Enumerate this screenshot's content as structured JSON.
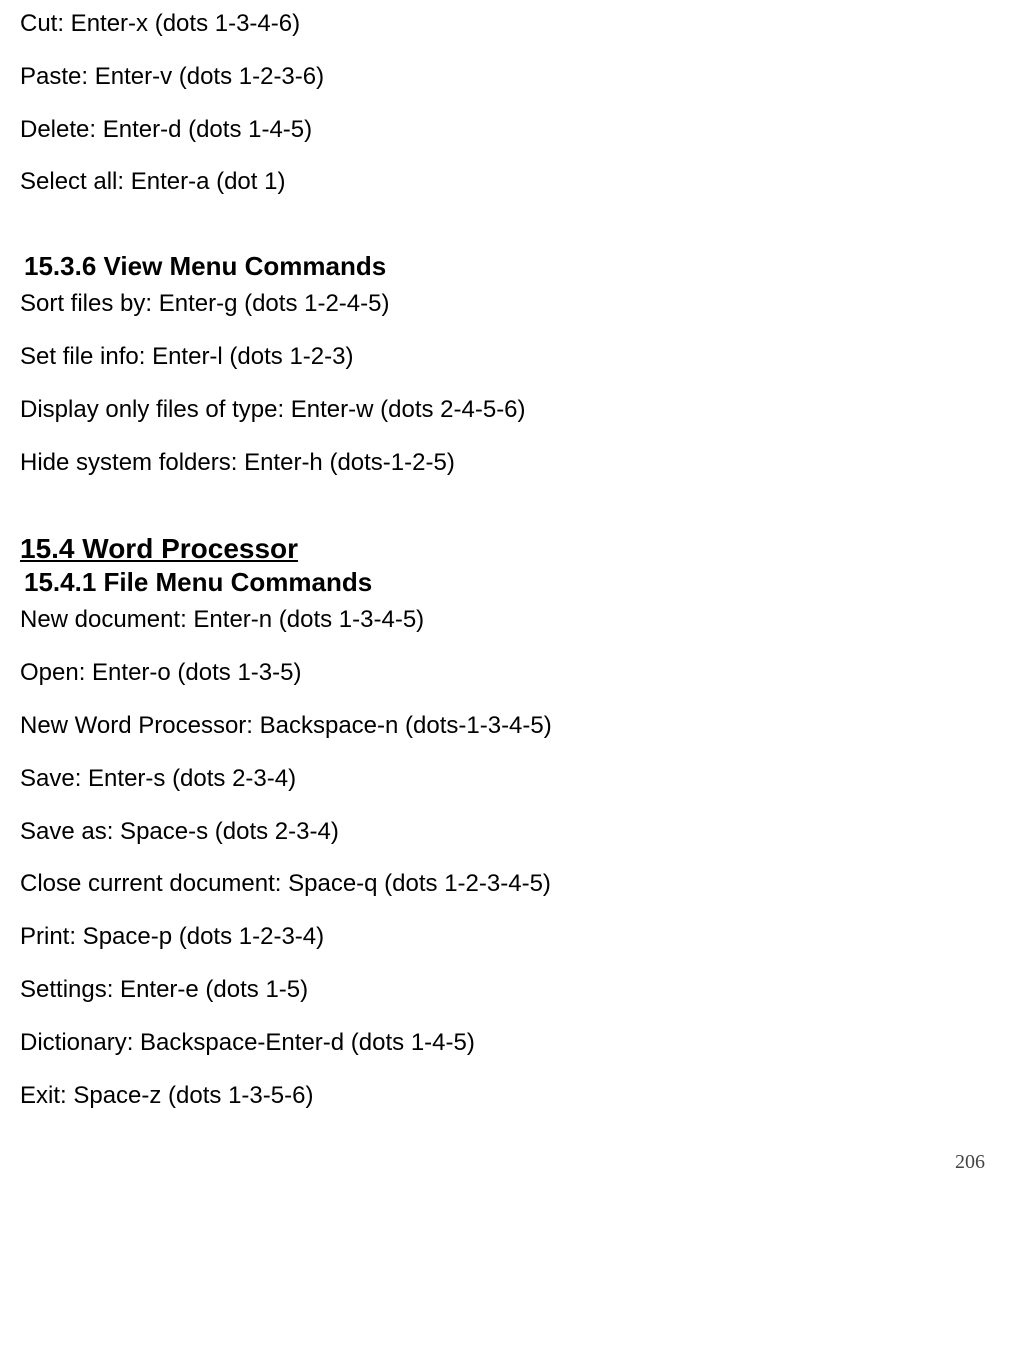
{
  "intro_cmds": [
    "Cut: Enter-x (dots 1-3-4-6)",
    "Paste: Enter-v (dots 1-2-3-6)",
    "Delete: Enter-d (dots 1-4-5)",
    "Select all: Enter-a (dot 1)"
  ],
  "view_menu": {
    "heading": "15.3.6 View Menu Commands",
    "cmds": [
      "Sort files by: Enter-g (dots 1-2-4-5)",
      "Set file info: Enter-l (dots 1-2-3)",
      "Display only files of type: Enter-w (dots 2-4-5-6)",
      "Hide system folders: Enter-h (dots-1-2-5)"
    ]
  },
  "word_processor": {
    "heading": "15.4 Word Processor",
    "file_menu": {
      "heading": "15.4.1 File Menu Commands",
      "cmds": [
        "New document: Enter-n (dots 1-3-4-5)",
        "Open: Enter-o (dots 1-3-5)",
        "New Word Processor: Backspace-n (dots-1-3-4-5)",
        "Save: Enter-s (dots 2-3-4)",
        "Save as: Space-s (dots 2-3-4)",
        "Close current document: Space-q (dots 1-2-3-4-5)",
        "Print: Space-p (dots 1-2-3-4)",
        "Settings: Enter-e (dots 1-5)",
        "Dictionary: Backspace-Enter-d (dots 1-4-5)",
        "Exit: Space-z (dots 1-3-5-6)"
      ]
    }
  },
  "page_number": "206"
}
